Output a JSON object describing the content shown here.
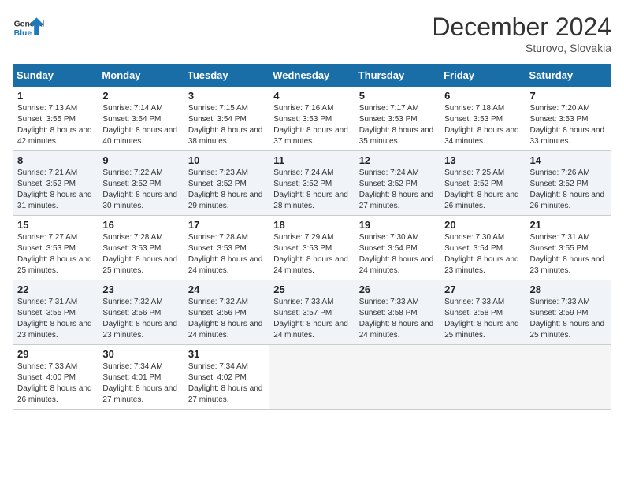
{
  "header": {
    "logo_general": "General",
    "logo_blue": "Blue",
    "month_title": "December 2024",
    "location": "Sturovo, Slovakia"
  },
  "days_of_week": [
    "Sunday",
    "Monday",
    "Tuesday",
    "Wednesday",
    "Thursday",
    "Friday",
    "Saturday"
  ],
  "weeks": [
    [
      {
        "day": "1",
        "sunrise": "7:13 AM",
        "sunset": "3:55 PM",
        "daylight": "8 hours and 42 minutes."
      },
      {
        "day": "2",
        "sunrise": "7:14 AM",
        "sunset": "3:54 PM",
        "daylight": "8 hours and 40 minutes."
      },
      {
        "day": "3",
        "sunrise": "7:15 AM",
        "sunset": "3:54 PM",
        "daylight": "8 hours and 38 minutes."
      },
      {
        "day": "4",
        "sunrise": "7:16 AM",
        "sunset": "3:53 PM",
        "daylight": "8 hours and 37 minutes."
      },
      {
        "day": "5",
        "sunrise": "7:17 AM",
        "sunset": "3:53 PM",
        "daylight": "8 hours and 35 minutes."
      },
      {
        "day": "6",
        "sunrise": "7:18 AM",
        "sunset": "3:53 PM",
        "daylight": "8 hours and 34 minutes."
      },
      {
        "day": "7",
        "sunrise": "7:20 AM",
        "sunset": "3:53 PM",
        "daylight": "8 hours and 33 minutes."
      }
    ],
    [
      {
        "day": "8",
        "sunrise": "7:21 AM",
        "sunset": "3:52 PM",
        "daylight": "8 hours and 31 minutes."
      },
      {
        "day": "9",
        "sunrise": "7:22 AM",
        "sunset": "3:52 PM",
        "daylight": "8 hours and 30 minutes."
      },
      {
        "day": "10",
        "sunrise": "7:23 AM",
        "sunset": "3:52 PM",
        "daylight": "8 hours and 29 minutes."
      },
      {
        "day": "11",
        "sunrise": "7:24 AM",
        "sunset": "3:52 PM",
        "daylight": "8 hours and 28 minutes."
      },
      {
        "day": "12",
        "sunrise": "7:24 AM",
        "sunset": "3:52 PM",
        "daylight": "8 hours and 27 minutes."
      },
      {
        "day": "13",
        "sunrise": "7:25 AM",
        "sunset": "3:52 PM",
        "daylight": "8 hours and 26 minutes."
      },
      {
        "day": "14",
        "sunrise": "7:26 AM",
        "sunset": "3:52 PM",
        "daylight": "8 hours and 26 minutes."
      }
    ],
    [
      {
        "day": "15",
        "sunrise": "7:27 AM",
        "sunset": "3:53 PM",
        "daylight": "8 hours and 25 minutes."
      },
      {
        "day": "16",
        "sunrise": "7:28 AM",
        "sunset": "3:53 PM",
        "daylight": "8 hours and 25 minutes."
      },
      {
        "day": "17",
        "sunrise": "7:28 AM",
        "sunset": "3:53 PM",
        "daylight": "8 hours and 24 minutes."
      },
      {
        "day": "18",
        "sunrise": "7:29 AM",
        "sunset": "3:53 PM",
        "daylight": "8 hours and 24 minutes."
      },
      {
        "day": "19",
        "sunrise": "7:30 AM",
        "sunset": "3:54 PM",
        "daylight": "8 hours and 24 minutes."
      },
      {
        "day": "20",
        "sunrise": "7:30 AM",
        "sunset": "3:54 PM",
        "daylight": "8 hours and 23 minutes."
      },
      {
        "day": "21",
        "sunrise": "7:31 AM",
        "sunset": "3:55 PM",
        "daylight": "8 hours and 23 minutes."
      }
    ],
    [
      {
        "day": "22",
        "sunrise": "7:31 AM",
        "sunset": "3:55 PM",
        "daylight": "8 hours and 23 minutes."
      },
      {
        "day": "23",
        "sunrise": "7:32 AM",
        "sunset": "3:56 PM",
        "daylight": "8 hours and 23 minutes."
      },
      {
        "day": "24",
        "sunrise": "7:32 AM",
        "sunset": "3:56 PM",
        "daylight": "8 hours and 24 minutes."
      },
      {
        "day": "25",
        "sunrise": "7:33 AM",
        "sunset": "3:57 PM",
        "daylight": "8 hours and 24 minutes."
      },
      {
        "day": "26",
        "sunrise": "7:33 AM",
        "sunset": "3:58 PM",
        "daylight": "8 hours and 24 minutes."
      },
      {
        "day": "27",
        "sunrise": "7:33 AM",
        "sunset": "3:58 PM",
        "daylight": "8 hours and 25 minutes."
      },
      {
        "day": "28",
        "sunrise": "7:33 AM",
        "sunset": "3:59 PM",
        "daylight": "8 hours and 25 minutes."
      }
    ],
    [
      {
        "day": "29",
        "sunrise": "7:33 AM",
        "sunset": "4:00 PM",
        "daylight": "8 hours and 26 minutes."
      },
      {
        "day": "30",
        "sunrise": "7:34 AM",
        "sunset": "4:01 PM",
        "daylight": "8 hours and 27 minutes."
      },
      {
        "day": "31",
        "sunrise": "7:34 AM",
        "sunset": "4:02 PM",
        "daylight": "8 hours and 27 minutes."
      },
      null,
      null,
      null,
      null
    ]
  ]
}
